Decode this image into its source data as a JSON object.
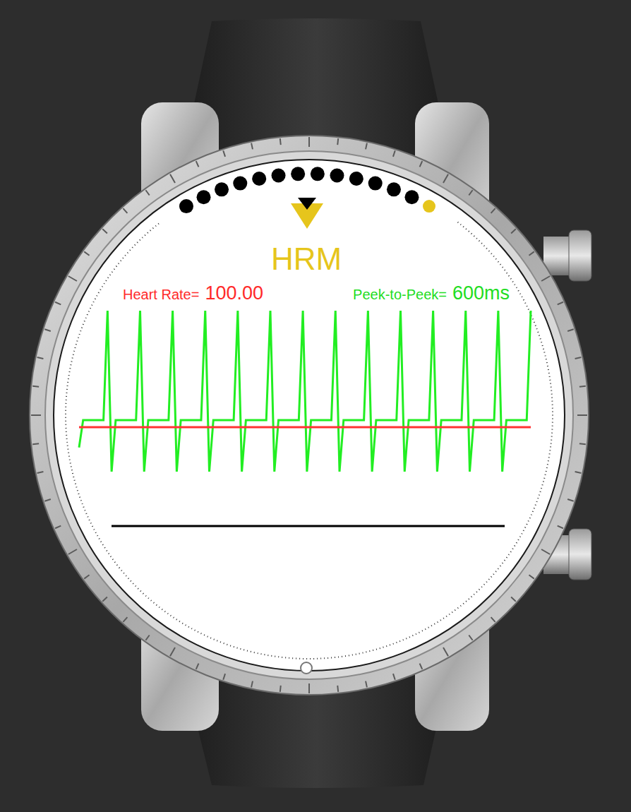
{
  "app": {
    "title": "HRM"
  },
  "page_indicator": [
    {
      "selected": false
    },
    {
      "selected": false
    },
    {
      "selected": false
    },
    {
      "selected": false
    },
    {
      "selected": false
    },
    {
      "selected": false
    },
    {
      "selected": false
    },
    {
      "selected": false
    },
    {
      "selected": false
    },
    {
      "selected": false
    },
    {
      "selected": false
    },
    {
      "selected": false
    },
    {
      "selected": false
    },
    {
      "selected": true
    }
  ],
  "readings": [
    {
      "label": "Heart Rate=",
      "value": "100.00",
      "color": "#ff2a2a"
    },
    {
      "label": "Peek-to-Peek=",
      "value": "600ms",
      "color": "#22dd22"
    }
  ],
  "chart": {
    "series": [
      {
        "color": "#22ee22",
        "values": [
          -0.25,
          0,
          0,
          0,
          0,
          0,
          0,
          1,
          -0.47,
          0,
          0,
          0,
          0,
          0,
          0,
          1,
          -0.47,
          0,
          0,
          0,
          0,
          0,
          0,
          1,
          -0.47,
          0,
          0,
          0,
          0,
          0,
          0,
          1,
          -0.47,
          0,
          0,
          0,
          0,
          0,
          0,
          1,
          -0.47,
          0,
          0,
          0,
          0,
          0,
          0,
          1,
          -0.47,
          0,
          0,
          0,
          0,
          0,
          0,
          1,
          -0.47,
          0,
          0,
          0,
          0,
          0,
          0,
          1,
          -0.47,
          0,
          0,
          0,
          0,
          0,
          0,
          1,
          -0.47,
          0,
          0,
          0,
          0,
          0,
          0,
          1,
          -0.47,
          0,
          0,
          0,
          0,
          0,
          0,
          1,
          -0.47,
          0,
          0,
          0,
          0,
          0,
          0,
          1,
          -0.47,
          0,
          0,
          0,
          0,
          0,
          0,
          1,
          -0.47,
          0,
          0,
          0,
          0,
          0,
          0,
          1
        ]
      },
      {
        "color": "#ff3333",
        "values": [
          -0.065,
          -0.065
        ]
      }
    ]
  }
}
